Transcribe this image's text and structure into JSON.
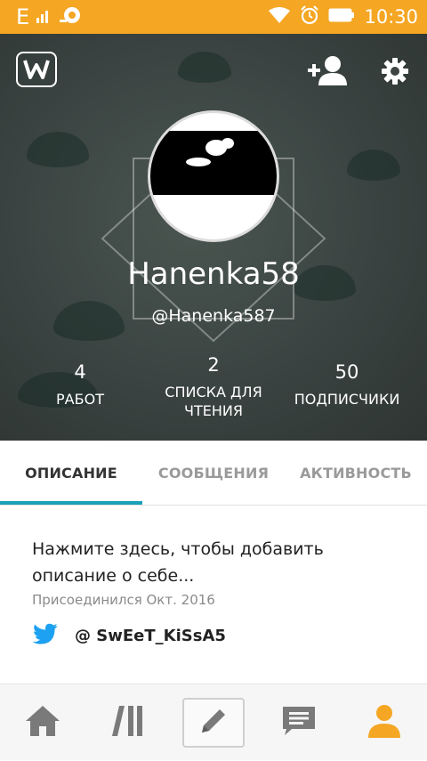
{
  "status_bar": {
    "left_indicator": "E",
    "time": "10:30",
    "icons": [
      "signal-icon",
      "wifi-icon",
      "alarm-icon",
      "battery-icon"
    ]
  },
  "header": {
    "display_name": "Hanenka58",
    "username": "@Hanenka587",
    "stats": [
      {
        "value": "4",
        "label": "РАБОТ"
      },
      {
        "value": "2",
        "label": "СПИСКА ДЛЯ ЧТЕНИЯ"
      },
      {
        "value": "50",
        "label": "ПОДПИСЧИКИ"
      }
    ],
    "icons": [
      "wattpad-logo-icon",
      "add-friend-icon",
      "settings-icon"
    ]
  },
  "tabs": [
    {
      "label": "ОПИСАНИЕ",
      "active": true
    },
    {
      "label": "СООБЩЕНИЯ",
      "active": false
    },
    {
      "label": "АКТИВНОСТЬ",
      "active": false
    }
  ],
  "about": {
    "description_prompt": "Нажмите здесь, чтобы добавить описание о себе...",
    "joined": "Присоединился Окт. 2016",
    "twitter_handle": "@ SwEeT_KiSsA5"
  },
  "bottom_nav": [
    "home-icon",
    "library-icon",
    "write-icon",
    "messages-icon",
    "profile-icon"
  ],
  "colors": {
    "status_bar": "#f5a623",
    "accent": "#1aa0b8",
    "active_nav": "#f5a623",
    "twitter": "#1da1f2"
  }
}
